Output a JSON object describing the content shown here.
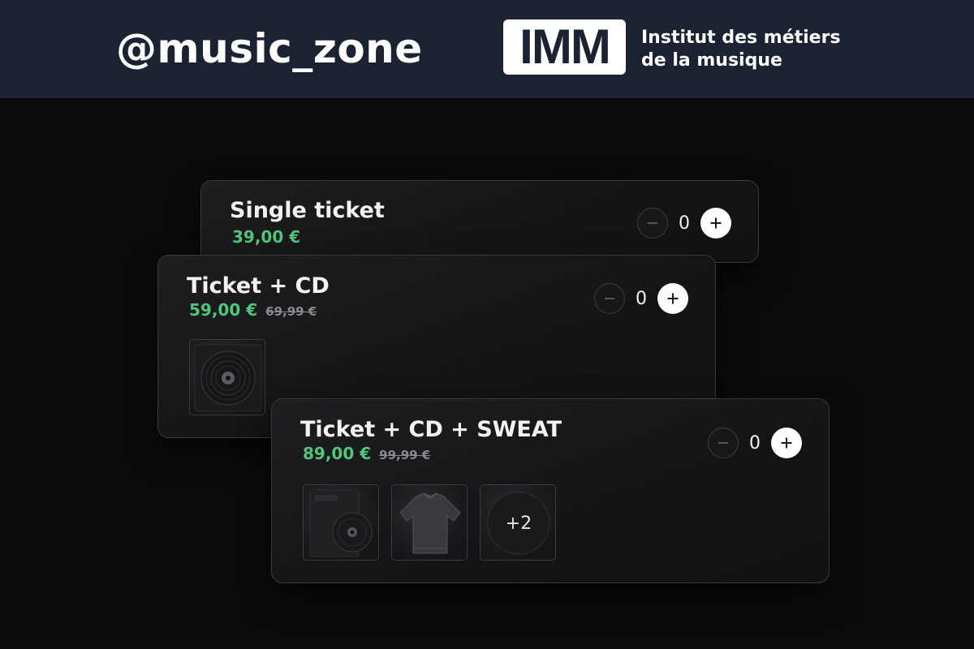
{
  "banner": {
    "handle": "@music_zone",
    "logo_text": "IMM",
    "org_line1": "Institut des métiers",
    "org_line2": "de la musique",
    "background_color": "#1b2232"
  },
  "products": [
    {
      "title": "Single ticket",
      "price": "39,00 €",
      "old_price": "",
      "quantity": "0"
    },
    {
      "title": "Ticket + CD",
      "price": "59,00 €",
      "old_price": "69,99 €",
      "quantity": "0",
      "thumbnails": [
        "cd-thumbnail"
      ]
    },
    {
      "title": "Ticket + CD + SWEAT",
      "price": "89,00 €",
      "old_price": "99,99 €",
      "quantity": "0",
      "thumbnails": [
        "cd-thumbnail",
        "sweatshirt-thumbnail"
      ],
      "more_label": "+2"
    }
  ],
  "icons": {
    "minus": "minus-icon",
    "plus": "plus-icon"
  },
  "colors": {
    "price": "#4fc77b",
    "old_price": "#8a8a8e",
    "card_border": "#3a3a3e",
    "page_background": "#0b0b0c"
  }
}
